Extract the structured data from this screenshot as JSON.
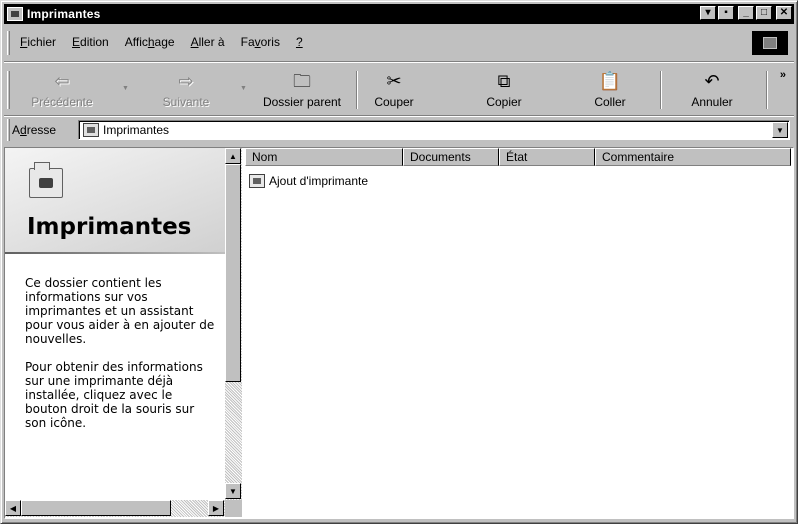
{
  "window": {
    "title": "Imprimantes",
    "buttons": [
      "▾",
      "▪",
      "_",
      "□",
      "✕"
    ]
  },
  "menu": {
    "items": [
      {
        "prefix": "",
        "accel": "F",
        "rest": "ichier"
      },
      {
        "prefix": "",
        "accel": "E",
        "rest": "dition"
      },
      {
        "prefix": "Affic",
        "accel": "h",
        "rest": "age"
      },
      {
        "prefix": "",
        "accel": "A",
        "rest": "ller à"
      },
      {
        "prefix": "Fa",
        "accel": "v",
        "rest": "oris"
      },
      {
        "prefix": "",
        "accel": "?",
        "rest": ""
      }
    ]
  },
  "toolbar": {
    "back_label": "Précédente",
    "forward_label": "Suivante",
    "parent_label": "Dossier parent",
    "cut_label": "Couper",
    "copy_label": "Copier",
    "paste_label": "Coller",
    "undo_label": "Annuler",
    "more_glyph": "»"
  },
  "address": {
    "label_prefix": "A",
    "label_accel": "d",
    "label_rest": "resse",
    "value": "Imprimantes"
  },
  "left_pane": {
    "title": "Imprimantes",
    "paragraph1": "Ce dossier contient les informations sur vos imprimantes et un assistant pour vous aider à en ajouter de nouvelles.",
    "paragraph2": "Pour obtenir des informations sur une imprimante déjà installée, cliquez avec le bouton droit de la souris sur son icône."
  },
  "list": {
    "columns": [
      "Nom",
      "Documents",
      "État",
      "Commentaire"
    ],
    "items": [
      {
        "name": "Ajout d'imprimante",
        "icon": "add-printer-icon"
      }
    ]
  }
}
